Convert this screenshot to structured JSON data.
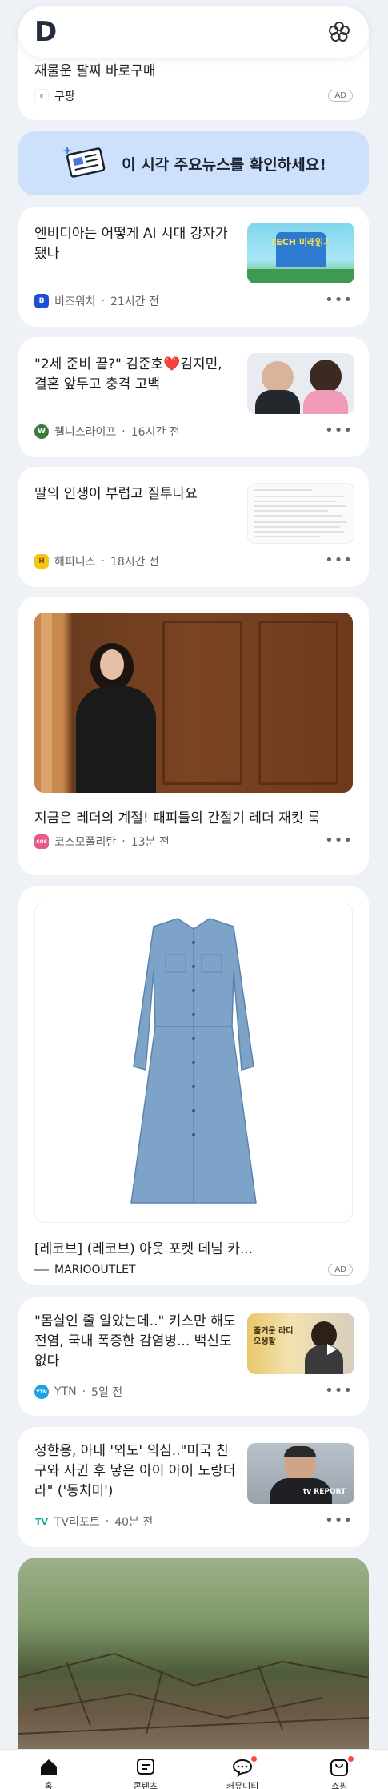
{
  "header": {
    "logo": "D",
    "flower_icon": "flower-icon"
  },
  "ad_card_top": {
    "title": "재물운 팔찌 바로구매",
    "source": "쿠팡",
    "badge": "AD"
  },
  "banner": {
    "text": "이 시각 주요뉴스를 확인하세요!",
    "icon": "newspaper-icon"
  },
  "news": [
    {
      "title": "엔비디아는 어떻게 AI 시대 강자가 됐나",
      "source": "비즈워치",
      "time": "21시간 전",
      "source_icon_text": "B",
      "source_color": "#1a4fd6"
    },
    {
      "title": "\"2세 준비 끝?\" 김준호❤️김지민, 결혼 앞두고 충격 고백",
      "source": "웰니스라이프",
      "time": "16시간 전",
      "source_icon_text": "W",
      "source_color": "#3b7a3a"
    },
    {
      "title": "딸의 인생이 부럽고 질투나요",
      "source": "해피니스",
      "time": "18시간 전",
      "source_icon_text": "H",
      "source_color": "#f5c518"
    }
  ],
  "feature": {
    "title": "지금은 레더의 계절! 패피들의 간절기 레더 재킷 룩",
    "source": "코스모폴리탄",
    "time": "13분 전",
    "source_icon_text": "COS",
    "source_color": "#e75a8c"
  },
  "ad_card_dress": {
    "title": "[레코브] (레코브) 아웃 포켓 데님 카...",
    "source": "MARIOOUTLET",
    "badge": "AD"
  },
  "news2": [
    {
      "title": "\"몸살인 줄 알았는데..\" 키스만 해도 전염, 국내 폭증한 감염병... 백신도 없다",
      "source": "YTN",
      "time": "5일 전",
      "source_icon_text": "YTN",
      "source_color": "#1aa3e0"
    },
    {
      "title": "정한용, 아내 '외도' 의심..\"미국 친구와 사귄 후 낳은 아이 아이 노랑더라\" ('동치미')",
      "source": "TV리포트",
      "time": "40분 전",
      "source_icon_text": "TV",
      "source_color": "#1fae9b"
    }
  ],
  "thumb_texts": {
    "t1": "TECH 미래읽기",
    "t5": "즐거운 라디오생활",
    "t6": "tv REPORT"
  },
  "tabs": [
    {
      "label": "홈",
      "icon": "home-icon"
    },
    {
      "label": "콘텐츠",
      "icon": "contents-icon"
    },
    {
      "label": "커뮤니티",
      "icon": "chat-icon"
    },
    {
      "label": "쇼핑",
      "icon": "shopping-bag-icon"
    }
  ],
  "more_label": "•••",
  "sep": "·"
}
